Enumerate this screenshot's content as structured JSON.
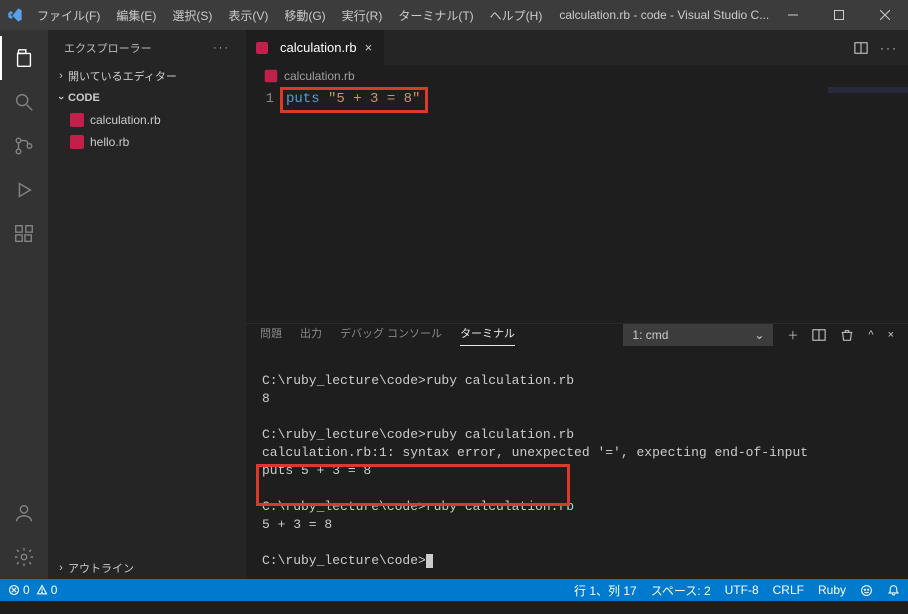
{
  "title_bar": {
    "menus": [
      "ファイル(F)",
      "編集(E)",
      "選択(S)",
      "表示(V)",
      "移動(G)",
      "実行(R)",
      "ターミナル(T)",
      "ヘルプ(H)"
    ],
    "title": "calculation.rb - code - Visual Studio C..."
  },
  "sidebar": {
    "header": "エクスプローラー",
    "open_editors_label": "開いているエディター",
    "root_name": "CODE",
    "files": [
      "calculation.rb",
      "hello.rb"
    ],
    "outline_label": "アウトライン"
  },
  "tabs": {
    "active_file": "calculation.rb"
  },
  "breadcrumb": {
    "file": "calculation.rb"
  },
  "editor": {
    "line_no": "1",
    "kw": "puts",
    "str": "\"5 + 3 = 8\""
  },
  "panel": {
    "tabs": [
      "問題",
      "出力",
      "デバッグ コンソール",
      "ターミナル"
    ],
    "active_tab_index": 3,
    "terminal_selector": "1: cmd",
    "lines": [
      "C:\\ruby_lecture\\code>ruby calculation.rb",
      "8",
      "",
      "C:\\ruby_lecture\\code>ruby calculation.rb",
      "calculation.rb:1: syntax error, unexpected '=', expecting end-of-input",
      "puts 5 + 3 = 8",
      "",
      "C:\\ruby_lecture\\code>ruby calculation.rb",
      "5 + 3 = 8",
      "",
      "C:\\ruby_lecture\\code>"
    ]
  },
  "status_bar": {
    "errors": "0",
    "warnings": "0",
    "cursor": "行 1、列 17",
    "spaces": "スペース: 2",
    "encoding": "UTF-8",
    "eol": "CRLF",
    "lang": "Ruby"
  }
}
